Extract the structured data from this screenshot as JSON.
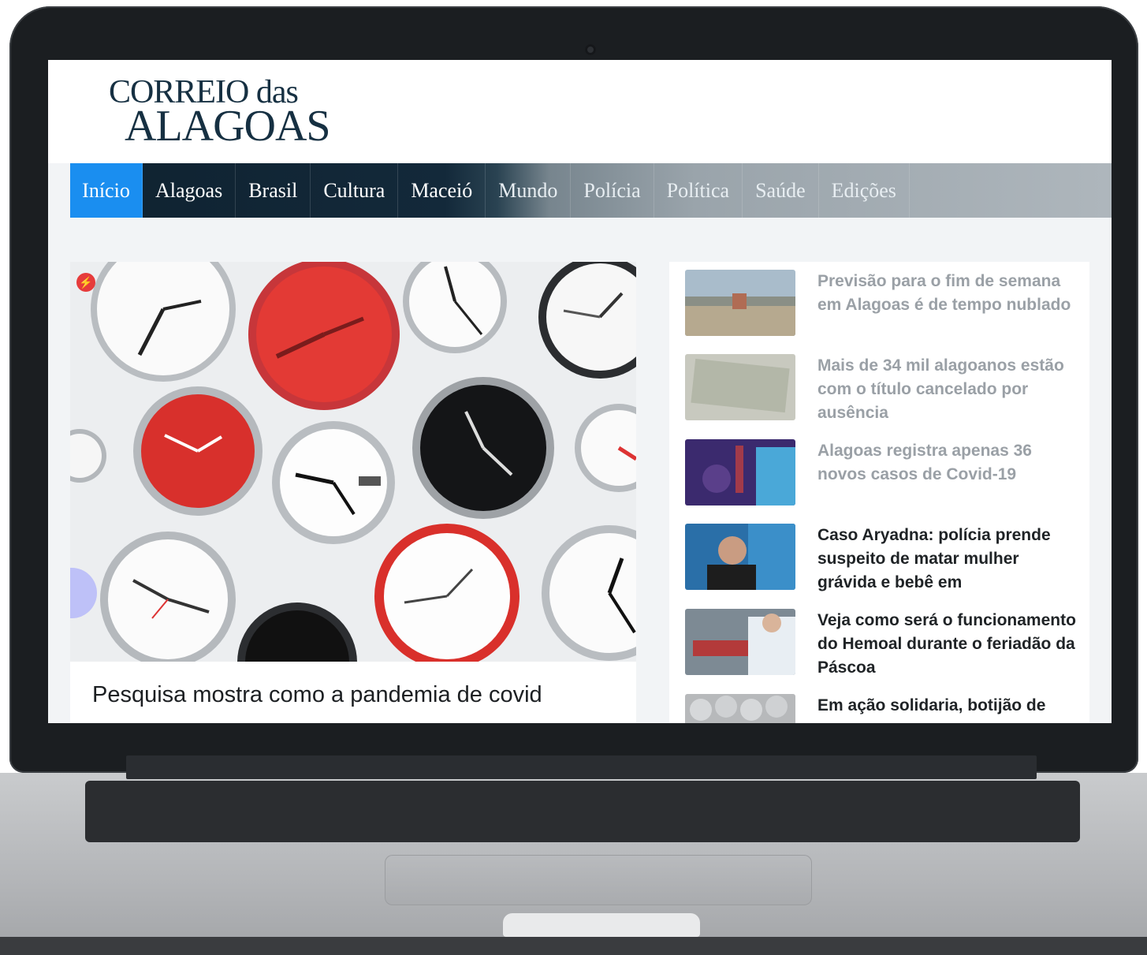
{
  "site": {
    "logo_line1": "CORREIO das",
    "logo_line2": "ALAGOAS"
  },
  "nav": {
    "items": [
      {
        "label": "Início"
      },
      {
        "label": "Alagoas"
      },
      {
        "label": "Brasil"
      },
      {
        "label": "Cultura"
      },
      {
        "label": "Maceió"
      },
      {
        "label": "Mundo"
      },
      {
        "label": "Polícia"
      },
      {
        "label": "Política"
      },
      {
        "label": "Saúde"
      },
      {
        "label": "Edições"
      }
    ],
    "active_index": 0,
    "active_color": "#1a8ef0",
    "bar_color": "#13293a"
  },
  "featured": {
    "headline": "Pesquisa mostra como a pandemia de covid",
    "image": "clocks-photo",
    "badge_icon": "flash-icon"
  },
  "sidebar": {
    "items": [
      {
        "title": "Previsão para o fim de semana em Alagoas é de tempo nublado",
        "image": "city-aerial-photo"
      },
      {
        "title": "Mais de 34 mil alagoanos estão com o título cancelado por ausência",
        "image": "voter-card-photo"
      },
      {
        "title": "Alagoas registra apenas 36 novos casos de Covid-19",
        "image": "covid-test-photo"
      },
      {
        "title": "Caso Aryadna: polícia prende suspeito de matar mulher grávida e bebê em",
        "image": "woman-portrait-photo"
      },
      {
        "title": "Veja como será o funcionamento do Hemoal durante o feriadão da Páscoa",
        "image": "blood-donation-photo"
      },
      {
        "title": "Em ação solidaria, botijão de",
        "image": "gas-cylinders-photo"
      }
    ]
  }
}
